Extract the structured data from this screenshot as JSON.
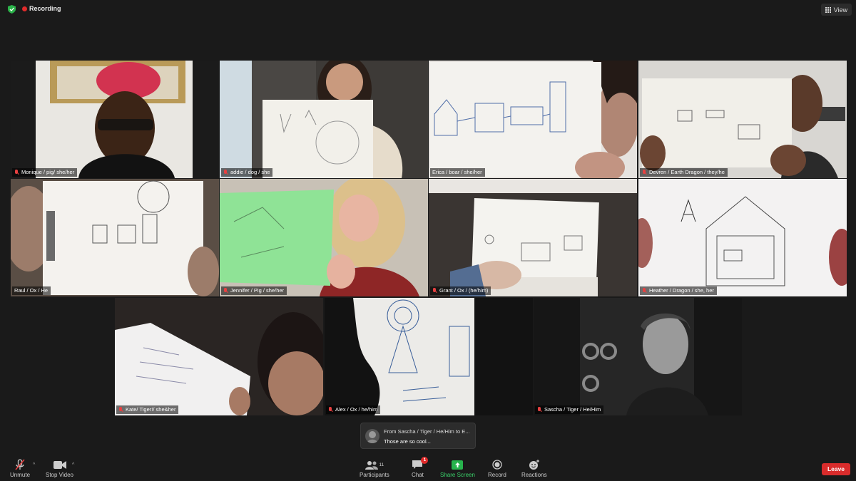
{
  "app": {
    "recording_label": "Recording",
    "view_label": "View"
  },
  "participants": [
    {
      "name": "Monique / pig/ she/her"
    },
    {
      "name": "addie / dog / she"
    },
    {
      "name": "Erica / boar / she/her"
    },
    {
      "name": "Devren / Earth Dragon / they/he"
    },
    {
      "name": "Raul / Ox / He"
    },
    {
      "name": "Jennifer / Pig / she/her"
    },
    {
      "name": "Grant / Ox / (he/him)"
    },
    {
      "name": "Heather / Dragon / she, her"
    },
    {
      "name": "Kate/ Tiger!/ she&her"
    },
    {
      "name": "Alex / Ox / he/him"
    },
    {
      "name": "Sascha / Tiger / He/Him"
    }
  ],
  "chat_toast": {
    "from": "From Sascha / Tiger / He/Him to E...",
    "message": "Those are so cool..."
  },
  "toolbar": {
    "unmute_label": "Unmute",
    "stop_video_label": "Stop Video",
    "participants_label": "Participants",
    "participants_count": "11",
    "chat_label": "Chat",
    "chat_badge": "1",
    "share_label": "Share Screen",
    "record_label": "Record",
    "reactions_label": "Reactions",
    "leave_label": "Leave"
  },
  "colors": {
    "active_speaker_border": "#d6e14a",
    "share_green": "#27b34d",
    "leave_red": "#d92c2c",
    "recording_red": "#e02b2b"
  }
}
